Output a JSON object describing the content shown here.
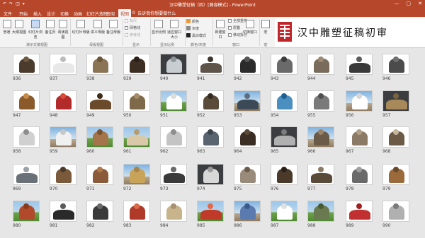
{
  "window": {
    "title": "汉中雕塑征稿（四）[兼容模式] - PowerPoint",
    "quick_access": [
      "↶",
      "↷",
      "◫",
      "▾"
    ],
    "controls": [
      "—",
      "▢",
      "✕"
    ]
  },
  "tabs": [
    "文件",
    "开始",
    "插入",
    "设计",
    "切换",
    "动画",
    "幻灯片放映",
    "审阅",
    "视图",
    "告诉我你想要做什么"
  ],
  "ribbon": {
    "views": [
      "普通",
      "大纲视图",
      "幻灯片浏览",
      "备注页",
      "阅读视图"
    ],
    "masters": [
      "幻灯片母版",
      "讲义母版",
      "备注母版"
    ],
    "show": [
      "标尺",
      "网格线",
      "参考线"
    ],
    "zoom": [
      "显示比例",
      "适应窗口大小"
    ],
    "color": [
      "颜色",
      "灰度",
      "黑白模式"
    ],
    "window": [
      "新建窗口",
      "全部重排",
      "层叠",
      "移动拆分"
    ],
    "switch": [
      "切换窗口"
    ],
    "macro": [
      "宏"
    ],
    "group_labels": [
      "演示文稿视图",
      "母版视图",
      "显示",
      "显示比例",
      "颜色/灰度",
      "窗口",
      "宏"
    ]
  },
  "banner": {
    "text": "汉中雕塑征稿初审",
    "accent": "#c0272d"
  },
  "slides": [
    {
      "n": "936",
      "bg": "#fff",
      "a": "#4a3b2c",
      "b": "#6d5a40"
    },
    {
      "n": "937",
      "bg": "#fff",
      "a": "#e8e8e8",
      "b": "#bdbdbd"
    },
    {
      "n": "938",
      "bg": "#fff",
      "a": "#8b7355",
      "b": "#6b5637"
    },
    {
      "n": "939",
      "bg": "#fff",
      "a": "#3d2e22",
      "b": "#2b1f17"
    },
    {
      "n": "940",
      "bg": "#3b3d40",
      "a": "#c8cdd2",
      "b": "#8e949a"
    },
    {
      "n": "941",
      "bg": "#fff",
      "a": "#5e5449",
      "b": "#3e352c"
    },
    {
      "n": "942",
      "bg": "#fff",
      "a": "#2b2b2b",
      "b": "#555"
    },
    {
      "n": "943",
      "bg": "#fff",
      "a": "#6a6a6a",
      "b": "#3c3c3c"
    },
    {
      "n": "944",
      "bg": "#fff",
      "a": "#7a6c5c",
      "b": "#9e8b73"
    },
    {
      "n": "945",
      "bg": "#fff",
      "a": "#3a3a3a",
      "b": "#5b5b5b"
    },
    {
      "n": "946",
      "bg": "#fff",
      "a": "#4b4b4b",
      "b": "#707070"
    },
    {
      "n": "947",
      "bg": "#fff",
      "a": "#8a5a2b",
      "b": "#c68a4a"
    },
    {
      "n": "948",
      "bg": "#fff",
      "a": "#b22a2a",
      "b": "#d84a3a"
    },
    {
      "n": "949",
      "bg": "#fff",
      "a": "#6b4a2b",
      "b": "#3e2a18"
    },
    {
      "n": "950",
      "bg": "#fff",
      "a": "#7e6a4a",
      "b": "#a38c66"
    },
    {
      "n": "951",
      "bg": "green",
      "a": "#ffffff",
      "b": "#dcdcdc"
    },
    {
      "n": "952",
      "bg": "#fff",
      "a": "#5a4a3a",
      "b": "#33291f"
    },
    {
      "n": "953",
      "bg": "sky",
      "a": "#3c4a58",
      "b": "#5e6e80"
    },
    {
      "n": "954",
      "bg": "#fff",
      "a": "#4a8fbf",
      "b": "#1f5f8f"
    },
    {
      "n": "955",
      "bg": "#fff",
      "a": "#7a7a7a",
      "b": "#4f4f4f"
    },
    {
      "n": "956",
      "bg": "sky",
      "a": "#ffffff",
      "b": "#d6d6d6"
    },
    {
      "n": "957",
      "bg": "#3b3d40",
      "a": "#a88a5a",
      "b": "#7a6240"
    },
    {
      "n": "958",
      "bg": "#fff",
      "a": "#d0d0d0",
      "b": "#8d8d8d"
    },
    {
      "n": "959",
      "bg": "sky",
      "a": "#f0f0f0",
      "b": "#c7c7c7"
    },
    {
      "n": "960",
      "bg": "green",
      "a": "#a5744a",
      "b": "#7a5231"
    },
    {
      "n": "961",
      "bg": "green",
      "a": "#d9c9a9",
      "b": "#b79d6e"
    },
    {
      "n": "962",
      "bg": "#fff",
      "a": "#c4c4c4",
      "b": "#8e8e8e"
    },
    {
      "n": "963",
      "bg": "#fff",
      "a": "#5a6470",
      "b": "#3c444d"
    },
    {
      "n": "964",
      "bg": "#fff",
      "a": "#3a2e24",
      "b": "#5a4838"
    },
    {
      "n": "965",
      "bg": "#3b3d40",
      "a": "#b0b0b0",
      "b": "#7c7c7c"
    },
    {
      "n": "966",
      "bg": "sky",
      "a": "#6a5a48",
      "b": "#9a8266"
    },
    {
      "n": "967",
      "bg": "#fff",
      "a": "#8a7a66",
      "b": "#b29f86"
    },
    {
      "n": "968",
      "bg": "#fff",
      "a": "#6b5a46",
      "b": "#c4b59c"
    },
    {
      "n": "969",
      "bg": "#fff",
      "a": "#6a7078",
      "b": "#9aa0a8"
    },
    {
      "n": "970",
      "bg": "#fff",
      "a": "#7a5a3a",
      "b": "#4a3a2a"
    },
    {
      "n": "971",
      "bg": "#fff",
      "a": "#8a5a3a",
      "b": "#b27a4a"
    },
    {
      "n": "972",
      "bg": "sky",
      "a": "#c8a45a",
      "b": "#a8844a"
    },
    {
      "n": "973",
      "bg": "#fff",
      "a": "#3a3a3a",
      "b": "#6a6a6a"
    },
    {
      "n": "974",
      "bg": "#3b3d40",
      "a": "#d8d8d8",
      "b": "#9a9a9a"
    },
    {
      "n": "975",
      "bg": "#fff",
      "a": "#9a8a7a",
      "b": "#6a5a4a"
    },
    {
      "n": "976",
      "bg": "#fff",
      "a": "#4a3a2a",
      "b": "#2a2018"
    },
    {
      "n": "977",
      "bg": "#fff",
      "a": "#5a4a3a",
      "b": "#8a7a66"
    },
    {
      "n": "978",
      "bg": "#fff",
      "a": "#6a6a6a",
      "b": "#a0a0a0"
    },
    {
      "n": "979",
      "bg": "#fff",
      "a": "#9a6a3a",
      "b": "#6a4a2a"
    },
    {
      "n": "980",
      "bg": "green",
      "a": "#b04a2a",
      "b": "#8a3a1a"
    },
    {
      "n": "981",
      "bg": "#fff",
      "a": "#2a2a2a",
      "b": "#5a5a5a"
    },
    {
      "n": "982",
      "bg": "#fff",
      "a": "#3a3a3a",
      "b": "#6a6a6a"
    },
    {
      "n": "983",
      "bg": "#fff",
      "a": "#b03a2a",
      "b": "#d86a4a"
    },
    {
      "n": "984",
      "bg": "#fff",
      "a": "#c8b48a",
      "b": "#a89070"
    },
    {
      "n": "985",
      "bg": "green",
      "a": "#c03a2a",
      "b": "#e06a4a"
    },
    {
      "n": "986",
      "bg": "sky",
      "a": "#5a7ab0",
      "b": "#3a5a8a"
    },
    {
      "n": "987",
      "bg": "green",
      "a": "#ffffff",
      "b": "#e0e0e0"
    },
    {
      "n": "988",
      "bg": "green",
      "a": "#6a7a50",
      "b": "#4a5a30"
    },
    {
      "n": "989",
      "bg": "#fff",
      "a": "#c03030",
      "b": "#a02020"
    },
    {
      "n": "990",
      "bg": "#fff",
      "a": "#b0b0b0",
      "b": "#7a7a7a"
    }
  ]
}
